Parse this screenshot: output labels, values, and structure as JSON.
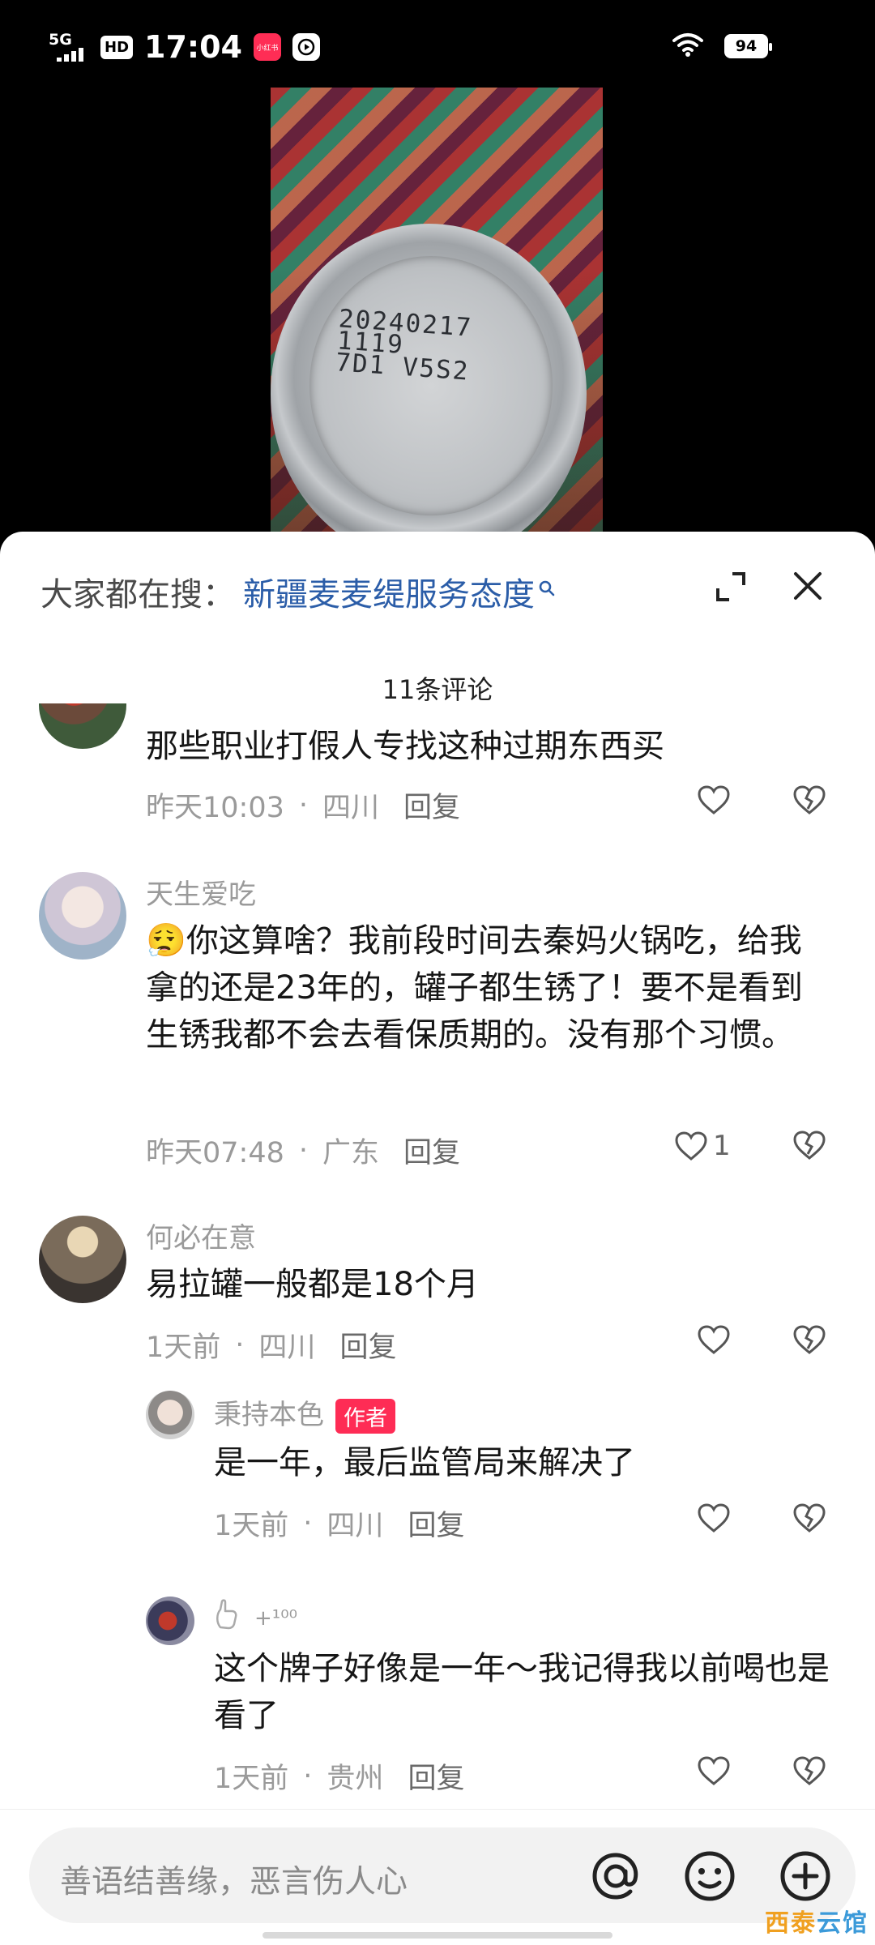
{
  "status_bar": {
    "network": "5G",
    "hd": "HD",
    "time": "17:04",
    "app_badge": "小红书",
    "battery": "94"
  },
  "video": {
    "code_line1": "20240217",
    "code_line2": "1119",
    "code_line3": "7D1 V5S2"
  },
  "search": {
    "label": "大家都在搜：",
    "query": "新疆麦麦缇服务态度"
  },
  "comments_title": "11条评论",
  "comments": [
    {
      "text": "那些职业打假人专找这种过期东西买",
      "time": "昨天10:03",
      "location": "四川",
      "reply": "回复",
      "likes": ""
    },
    {
      "user": "天生爱吃",
      "emoji": "😮‍💨",
      "text": "你这算啥？我前段时间去秦妈火锅吃，给我拿的还是23年的，罐子都生锈了！要不是看到生锈我都不会去看保质期的。没有那个习惯。",
      "time": "昨天07:48",
      "location": "广东",
      "reply": "回复",
      "likes": "1"
    },
    {
      "user": "何必在意",
      "text": "易拉罐一般都是18个月",
      "time": "1天前",
      "location": "四川",
      "reply": "回复",
      "likes": ""
    },
    {
      "user": "秉持本色",
      "badge": "作者",
      "text": "是一年，最后监管局来解决了",
      "time": "1天前",
      "location": "四川",
      "reply": "回复",
      "likes": ""
    },
    {
      "user": "+¹⁰⁰",
      "text": "这个牌子好像是一年～我记得我以前喝也是看了",
      "time": "1天前",
      "location": "贵州",
      "reply": "回复",
      "likes": ""
    }
  ],
  "input": {
    "placeholder": "善语结善缘，恶言伤人心"
  },
  "watermark": {
    "part1": "西泰",
    "part2": "云馆"
  },
  "colors": {
    "link": "#2b5da8",
    "author_badge": "#fe2c55",
    "meta": "#9a9a9a"
  }
}
